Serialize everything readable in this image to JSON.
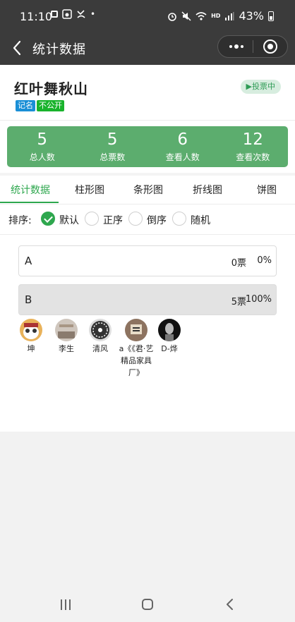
{
  "status_bar": {
    "time": "11:10",
    "dot": "•",
    "network": "HD",
    "battery": "43%"
  },
  "nav": {
    "title": "统计数据"
  },
  "poll": {
    "title": "红叶舞秋山",
    "tags": [
      "记名",
      "不公开"
    ],
    "status": "投票中",
    "status_icon": "▶"
  },
  "stats": [
    {
      "value": "5",
      "label": "总人数"
    },
    {
      "value": "5",
      "label": "总票数"
    },
    {
      "value": "6",
      "label": "查看人数"
    },
    {
      "value": "12",
      "label": "查看次数"
    }
  ],
  "tabs": [
    "统计数据",
    "柱形图",
    "条形图",
    "折线图",
    "饼图"
  ],
  "active_tab": 0,
  "sort": {
    "label": "排序:",
    "options": [
      "默认",
      "正序",
      "倒序",
      "随机"
    ],
    "selected": 0
  },
  "options": [
    {
      "name": "A",
      "votes": "0票",
      "percent": "0%",
      "share": 0
    },
    {
      "name": "B",
      "votes": "5票",
      "percent": "100%",
      "share": 1
    }
  ],
  "voters": [
    {
      "name": "坤"
    },
    {
      "name": "李生"
    },
    {
      "name": "清风"
    },
    {
      "name": "a《《君·艺精品家具厂》"
    },
    {
      "name": "D-烨"
    }
  ],
  "colors": {
    "accent": "#2ea74e",
    "stats_bg": "#5cad6e",
    "tag_named": "#1a8fd6",
    "tag_private": "#19b32c",
    "header_bg": "#3b3b3b"
  }
}
